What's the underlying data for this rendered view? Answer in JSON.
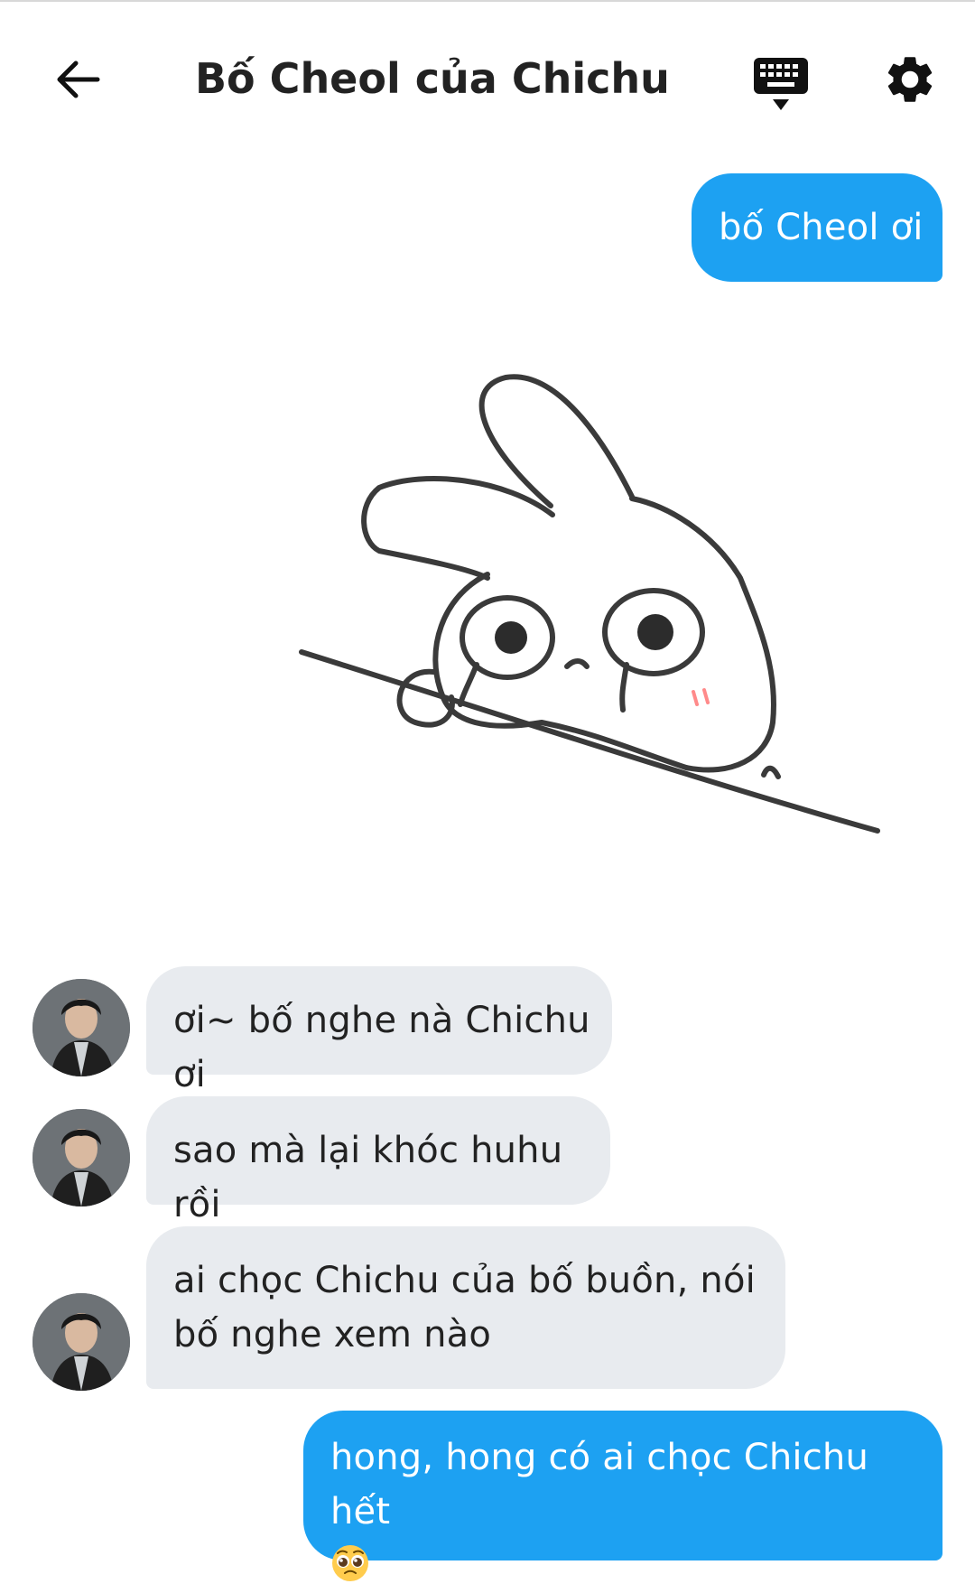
{
  "header": {
    "title": "Bố Cheol của Chichu",
    "back_icon": "arrow-left-icon",
    "keyboard_icon": "keyboard-hide-icon",
    "settings_icon": "gear-icon"
  },
  "colors": {
    "outgoing_bubble": "#1da1f2",
    "incoming_bubble": "#e8ebef",
    "text_dark": "#222222"
  },
  "messages": [
    {
      "direction": "out",
      "text": "bố Cheol ơi"
    },
    {
      "direction": "out",
      "type": "sticker",
      "sticker": "crying-bunny-sticker"
    },
    {
      "direction": "in",
      "text": "ơi~ bố nghe nà Chichu ơi"
    },
    {
      "direction": "in",
      "text": "sao mà lại khóc huhu rồi"
    },
    {
      "direction": "in",
      "text": "ai chọc Chichu của bố buồn, nói bố nghe xem nào"
    },
    {
      "direction": "out",
      "text": "hong, hong có ai chọc Chichu hết",
      "emoji": "pleading-face-emoji"
    }
  ]
}
